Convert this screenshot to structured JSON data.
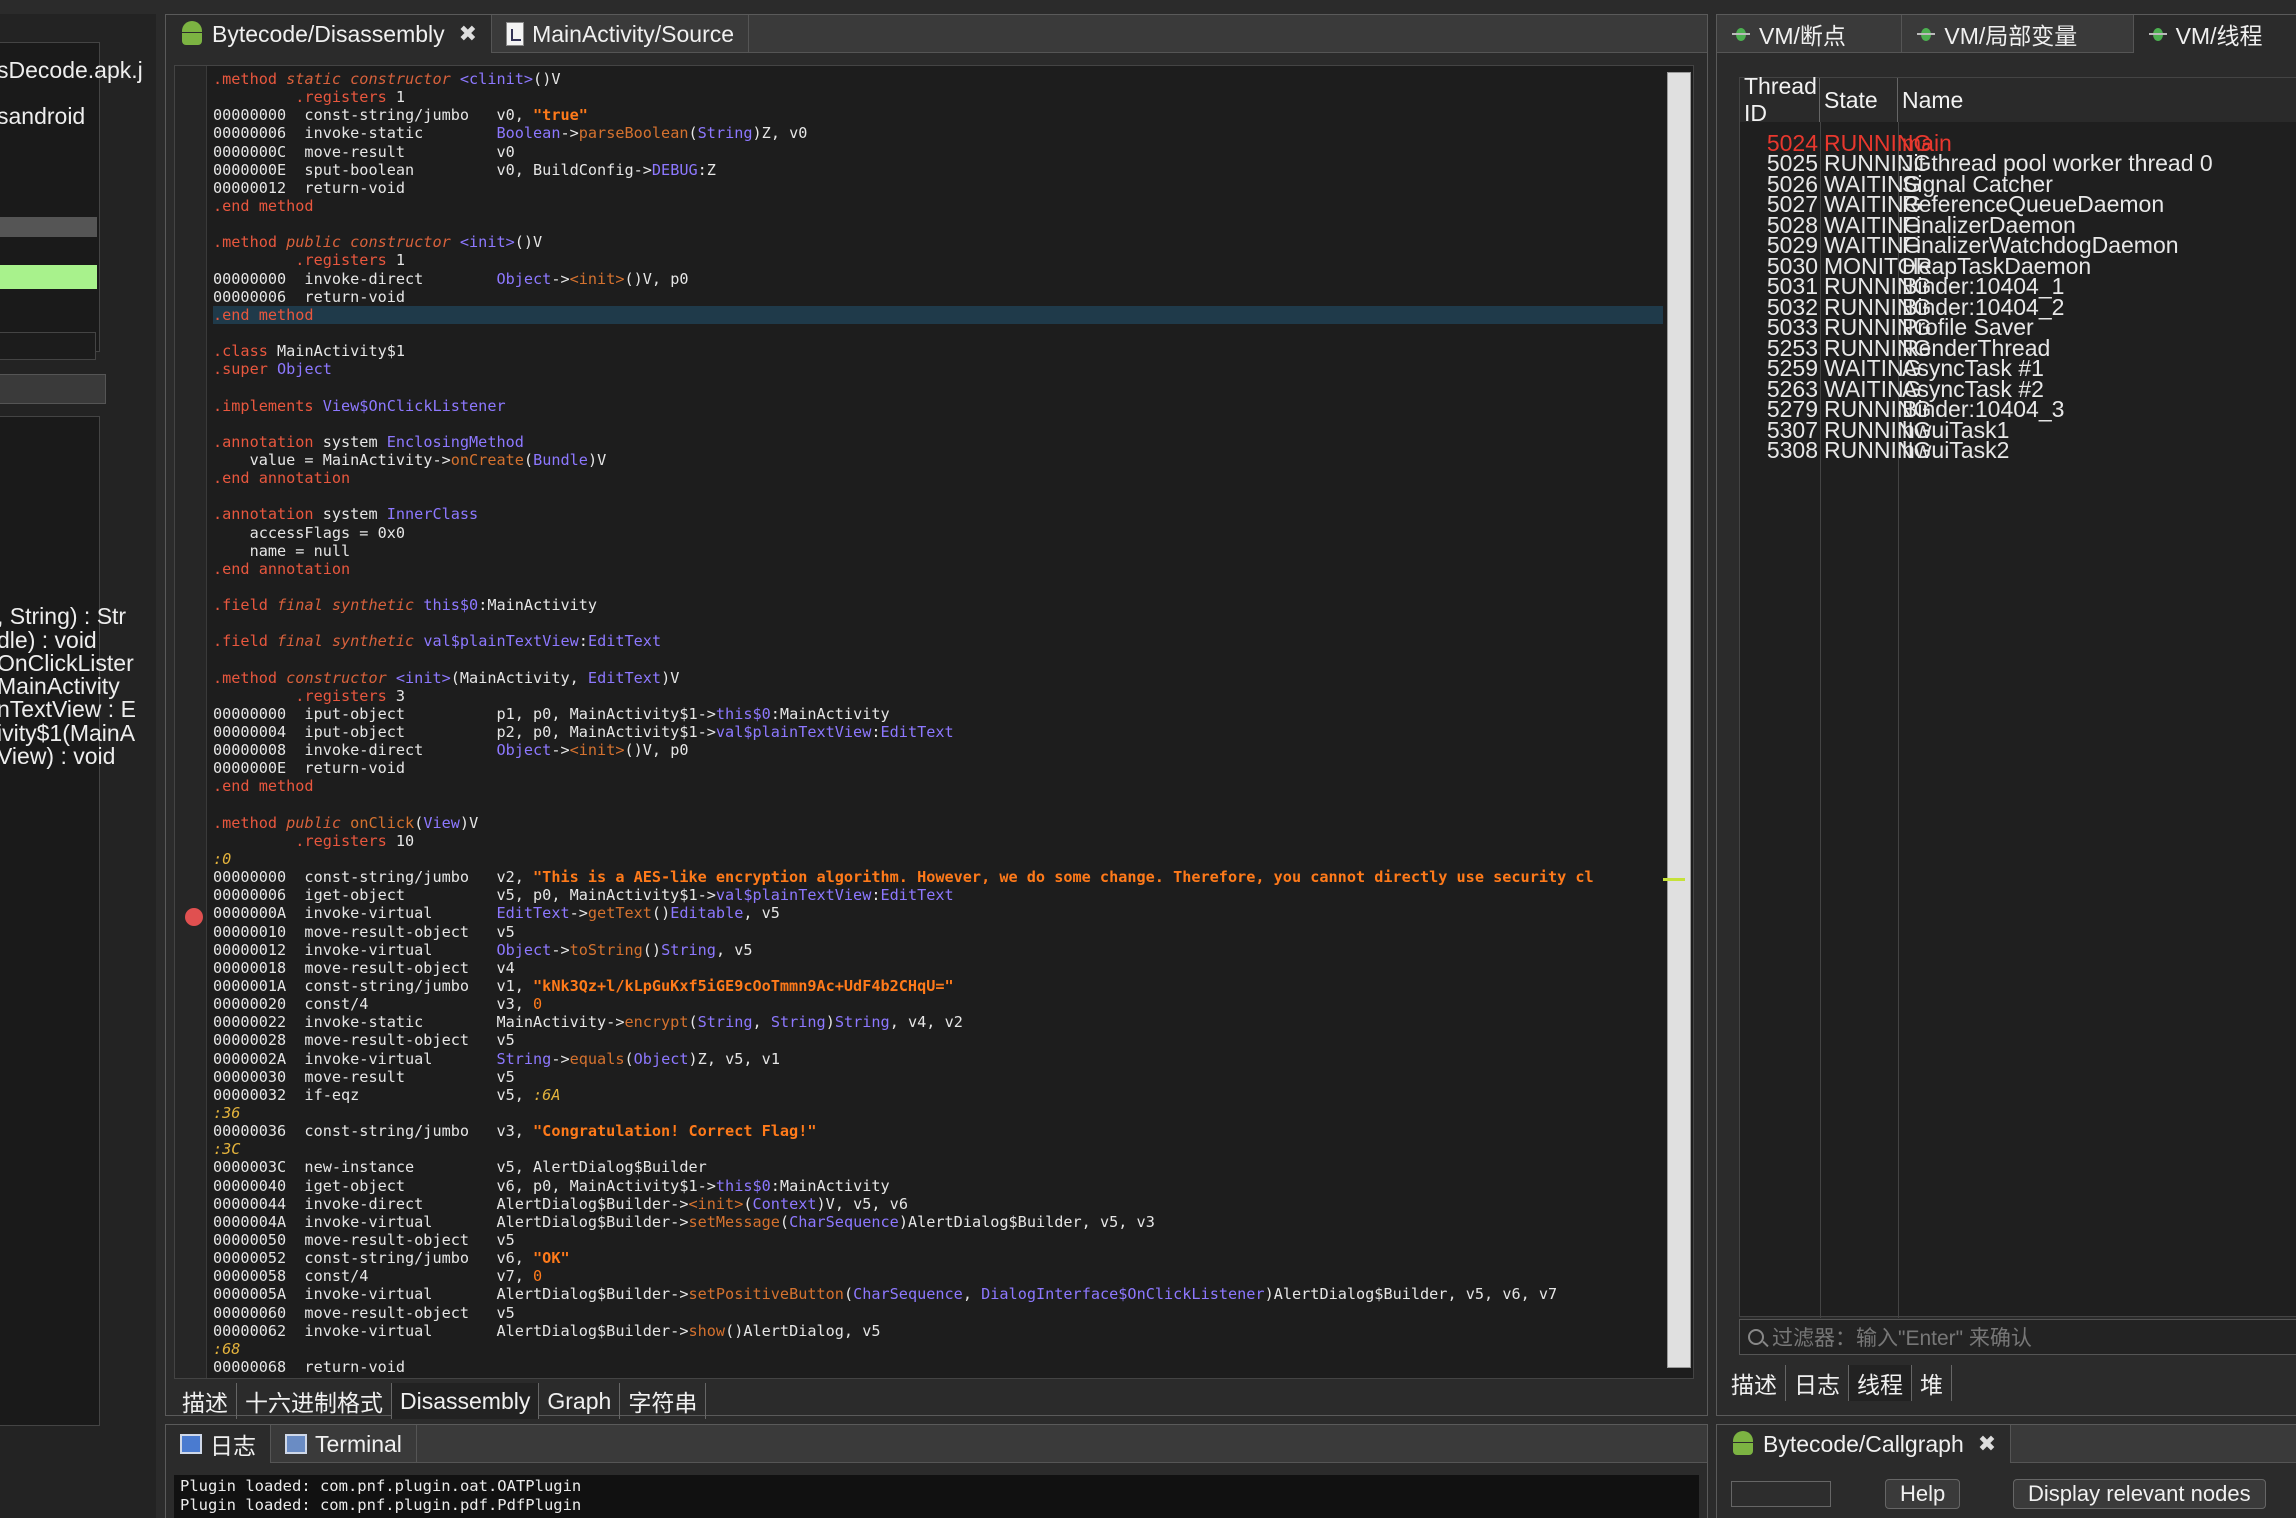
{
  "left_panel": {
    "lines_top": [
      "sDecode.apk.j",
      "sandroid"
    ],
    "lines_members": [
      ", String) : Str",
      "dle) : void",
      "OnClickLister",
      "MainActivity",
      "nTextView : E",
      "ivity$1(MainA",
      "View) : void"
    ]
  },
  "center": {
    "tabs": [
      {
        "label": "Bytecode/Disassembly",
        "close": "✖"
      },
      {
        "label": "MainActivity/Source"
      }
    ],
    "bottom_tabs": [
      "描述",
      "十六进制格式",
      "Disassembly",
      "Graph",
      "字符串"
    ],
    "code": [
      [
        [
          "kw",
          ".method "
        ],
        [
          "it",
          "static constructor "
        ],
        [
          "ty",
          "<clinit>"
        ],
        [
          "",
          "()V"
        ]
      ],
      [
        [
          "",
          "         "
        ],
        [
          "kw",
          ".registers "
        ],
        [
          "",
          "1"
        ]
      ],
      [
        [
          "",
          "00000000  const-string/jumbo   v0, "
        ],
        [
          "str",
          "\"true\""
        ]
      ],
      [
        [
          "",
          "00000006  invoke-static        "
        ],
        [
          "ty",
          "Boolean"
        ],
        [
          "",
          "->"
        ],
        [
          "fn",
          "parseBoolean"
        ],
        [
          "",
          "("
        ],
        [
          "ty",
          "String"
        ],
        [
          "",
          ")Z, v0"
        ]
      ],
      [
        [
          "",
          "0000000C  move-result          v0"
        ]
      ],
      [
        [
          "",
          "0000000E  sput-boolean         v0, BuildConfig->"
        ],
        [
          "ty",
          "DEBUG"
        ],
        [
          "",
          ":Z"
        ]
      ],
      [
        [
          "",
          "00000012  return-void"
        ]
      ],
      [
        [
          "kw",
          ".end method"
        ]
      ],
      [
        [
          "",
          ""
        ]
      ],
      [
        [
          "kw",
          ".method "
        ],
        [
          "it",
          "public constructor "
        ],
        [
          "ty",
          "<init>"
        ],
        [
          "",
          "()V"
        ]
      ],
      [
        [
          "",
          "         "
        ],
        [
          "kw",
          ".registers "
        ],
        [
          "",
          "1"
        ]
      ],
      [
        [
          "",
          "00000000  invoke-direct        "
        ],
        [
          "ty",
          "Object"
        ],
        [
          "",
          "->"
        ],
        [
          "fn",
          "<init>"
        ],
        [
          "",
          "()V, p0"
        ]
      ],
      [
        [
          "",
          "00000006  return-void"
        ]
      ],
      [
        [
          "kw",
          ".end method"
        ]
      ],
      [
        [
          "",
          ""
        ]
      ],
      [
        [
          "kw",
          ".class "
        ],
        [
          "",
          "MainActivity$1"
        ]
      ],
      [
        [
          "kw",
          ".super "
        ],
        [
          "ty",
          "Object"
        ]
      ],
      [
        [
          "",
          ""
        ]
      ],
      [
        [
          "kw",
          ".implements "
        ],
        [
          "ty",
          "View$OnClickListener"
        ]
      ],
      [
        [
          "",
          ""
        ]
      ],
      [
        [
          "kw",
          ".annotation "
        ],
        [
          "",
          "system "
        ],
        [
          "ty",
          "EnclosingMethod"
        ]
      ],
      [
        [
          "",
          "    value = MainActivity->"
        ],
        [
          "fn",
          "onCreate"
        ],
        [
          "",
          "("
        ],
        [
          "ty",
          "Bundle"
        ],
        [
          "",
          ")V"
        ]
      ],
      [
        [
          "kw",
          ".end annotation"
        ]
      ],
      [
        [
          "",
          ""
        ]
      ],
      [
        [
          "kw",
          ".annotation "
        ],
        [
          "",
          "system "
        ],
        [
          "ty",
          "InnerClass"
        ]
      ],
      [
        [
          "",
          "    accessFlags = 0x0"
        ]
      ],
      [
        [
          "",
          "    name = null"
        ]
      ],
      [
        [
          "kw",
          ".end annotation"
        ]
      ],
      [
        [
          "",
          ""
        ]
      ],
      [
        [
          "kw",
          ".field "
        ],
        [
          "it",
          "final synthetic "
        ],
        [
          "ty",
          "this$0"
        ],
        [
          "",
          ":MainActivity"
        ]
      ],
      [
        [
          "",
          ""
        ]
      ],
      [
        [
          "kw",
          ".field "
        ],
        [
          "it",
          "final synthetic "
        ],
        [
          "ty",
          "val$plainTextView"
        ],
        [
          "",
          ":"
        ],
        [
          "ty",
          "EditText"
        ]
      ],
      [
        [
          "",
          ""
        ]
      ],
      [
        [
          "kw",
          ".method "
        ],
        [
          "it",
          "constructor "
        ],
        [
          "ty",
          "<init>"
        ],
        [
          "",
          "(MainActivity, "
        ],
        [
          "ty",
          "EditText"
        ],
        [
          "",
          ")V"
        ]
      ],
      [
        [
          "",
          "         "
        ],
        [
          "kw",
          ".registers "
        ],
        [
          "",
          "3"
        ]
      ],
      [
        [
          "",
          "00000000  iput-object          p1, p0, MainActivity$1->"
        ],
        [
          "ty",
          "this$0"
        ],
        [
          "",
          ":MainActivity"
        ]
      ],
      [
        [
          "",
          "00000004  iput-object          p2, p0, MainActivity$1->"
        ],
        [
          "ty",
          "val$plainTextView"
        ],
        [
          "",
          ":"
        ],
        [
          "ty",
          "EditText"
        ]
      ],
      [
        [
          "",
          "00000008  invoke-direct        "
        ],
        [
          "ty",
          "Object"
        ],
        [
          "",
          "->"
        ],
        [
          "fn",
          "<init>"
        ],
        [
          "",
          "()V, p0"
        ]
      ],
      [
        [
          "",
          "0000000E  return-void"
        ]
      ],
      [
        [
          "kw",
          ".end method"
        ]
      ],
      [
        [
          "",
          ""
        ]
      ],
      [
        [
          "kw",
          ".method "
        ],
        [
          "it",
          "public "
        ],
        [
          "fn",
          "onClick"
        ],
        [
          "",
          "("
        ],
        [
          "ty",
          "View"
        ],
        [
          "",
          ")V"
        ]
      ],
      [
        [
          "",
          "         "
        ],
        [
          "kw",
          ".registers "
        ],
        [
          "",
          "10"
        ]
      ],
      [
        [
          "lbl",
          ":0"
        ]
      ],
      [
        [
          "",
          "00000000  const-string/jumbo   v2, "
        ],
        [
          "str",
          "\"This is a AES-like encryption algorithm. However, we do some change. Therefore, you cannot directly use security cl"
        ]
      ],
      [
        [
          "",
          "00000006  iget-object          v5, p0, MainActivity$1->"
        ],
        [
          "ty",
          "val$plainTextView"
        ],
        [
          "",
          ":"
        ],
        [
          "ty",
          "EditText"
        ]
      ],
      [
        [
          "",
          "0000000A  invoke-virtual       "
        ],
        [
          "ty",
          "EditText"
        ],
        [
          "",
          "->"
        ],
        [
          "fn",
          "getText"
        ],
        [
          "",
          "()"
        ],
        [
          "ty",
          "Editable"
        ],
        [
          "",
          ", v5"
        ]
      ],
      [
        [
          "",
          "00000010  move-result-object   v5"
        ]
      ],
      [
        [
          "",
          "00000012  invoke-virtual       "
        ],
        [
          "ty",
          "Object"
        ],
        [
          "",
          "->"
        ],
        [
          "fn",
          "toString"
        ],
        [
          "",
          "()"
        ],
        [
          "ty",
          "String"
        ],
        [
          "",
          ", v5"
        ]
      ],
      [
        [
          "",
          "00000018  move-result-object   v4"
        ]
      ],
      [
        [
          "",
          "0000001A  const-string/jumbo   v1, "
        ],
        [
          "str",
          "\"kNk3Qz+l/kLpGuKxf5iGE9cOoTmmn9Ac+UdF4b2CHqU=\""
        ]
      ],
      [
        [
          "",
          "00000020  const/4              v3, "
        ],
        [
          "num",
          "0"
        ]
      ],
      [
        [
          "",
          "00000022  invoke-static        MainActivity->"
        ],
        [
          "fn",
          "encrypt"
        ],
        [
          "",
          "("
        ],
        [
          "ty",
          "String"
        ],
        [
          "",
          ", "
        ],
        [
          "ty",
          "String"
        ],
        [
          "",
          ")"
        ],
        [
          "ty",
          "String"
        ],
        [
          "",
          ", v4, v2"
        ]
      ],
      [
        [
          "",
          "00000028  move-result-object   v5"
        ]
      ],
      [
        [
          "",
          "0000002A  invoke-virtual       "
        ],
        [
          "ty",
          "String"
        ],
        [
          "",
          "->"
        ],
        [
          "fn",
          "equals"
        ],
        [
          "",
          "("
        ],
        [
          "ty",
          "Object"
        ],
        [
          "",
          ")Z, v5, v1"
        ]
      ],
      [
        [
          "",
          "00000030  move-result          v5"
        ]
      ],
      [
        [
          "",
          "00000032  if-eqz               v5, "
        ],
        [
          "lbl",
          ":6A"
        ]
      ],
      [
        [
          "lbl",
          ":36"
        ]
      ],
      [
        [
          "",
          "00000036  const-string/jumbo   v3, "
        ],
        [
          "str",
          "\"Congratulation! Correct Flag!\""
        ]
      ],
      [
        [
          "lbl",
          ":3C"
        ]
      ],
      [
        [
          "",
          "0000003C  new-instance         v5, AlertDialog$Builder"
        ]
      ],
      [
        [
          "",
          "00000040  iget-object          v6, p0, MainActivity$1->"
        ],
        [
          "ty",
          "this$0"
        ],
        [
          "",
          ":MainActivity"
        ]
      ],
      [
        [
          "",
          "00000044  invoke-direct        AlertDialog$Builder->"
        ],
        [
          "fn",
          "<init>"
        ],
        [
          "",
          "("
        ],
        [
          "ty",
          "Context"
        ],
        [
          "",
          ")V, v5, v6"
        ]
      ],
      [
        [
          "",
          "0000004A  invoke-virtual       AlertDialog$Builder->"
        ],
        [
          "fn",
          "setMessage"
        ],
        [
          "",
          "("
        ],
        [
          "ty",
          "CharSequence"
        ],
        [
          "",
          ")AlertDialog$Builder, v5, v3"
        ]
      ],
      [
        [
          "",
          "00000050  move-result-object   v5"
        ]
      ],
      [
        [
          "",
          "00000052  const-string/jumbo   v6, "
        ],
        [
          "str",
          "\"OK\""
        ]
      ],
      [
        [
          "",
          "00000058  const/4              v7, "
        ],
        [
          "num",
          "0"
        ]
      ],
      [
        [
          "",
          "0000005A  invoke-virtual       AlertDialog$Builder->"
        ],
        [
          "fn",
          "setPositiveButton"
        ],
        [
          "",
          "("
        ],
        [
          "ty",
          "CharSequence"
        ],
        [
          "",
          ", "
        ],
        [
          "ty",
          "DialogInterface$OnClickListener"
        ],
        [
          "",
          ")AlertDialog$Builder, v5, v6, v7"
        ]
      ],
      [
        [
          "",
          "00000060  move-result-object   v5"
        ]
      ],
      [
        [
          "",
          "00000062  invoke-virtual       AlertDialog$Builder->"
        ],
        [
          "fn",
          "show"
        ],
        [
          "",
          "()AlertDialog, v5"
        ]
      ],
      [
        [
          "lbl",
          ":68"
        ]
      ],
      [
        [
          "",
          "00000068  return-void"
        ]
      ]
    ]
  },
  "vm": {
    "tabs": [
      "VM/断点",
      "VM/局部变量",
      "VM/线程"
    ],
    "columns": [
      "Thread ID",
      "State",
      "Name"
    ],
    "threads": [
      {
        "id": "5024",
        "state": "RUNNING",
        "name": "main"
      },
      {
        "id": "5025",
        "state": "RUNNING",
        "name": "Jit thread pool worker thread 0"
      },
      {
        "id": "5026",
        "state": "WAITING",
        "name": "Signal Catcher"
      },
      {
        "id": "5027",
        "state": "WAITING",
        "name": "ReferenceQueueDaemon"
      },
      {
        "id": "5028",
        "state": "WAITING",
        "name": "FinalizerDaemon"
      },
      {
        "id": "5029",
        "state": "WAITING",
        "name": "FinalizerWatchdogDaemon"
      },
      {
        "id": "5030",
        "state": "MONITOR",
        "name": "HeapTaskDaemon"
      },
      {
        "id": "5031",
        "state": "RUNNING",
        "name": "Binder:10404_1"
      },
      {
        "id": "5032",
        "state": "RUNNING",
        "name": "Binder:10404_2"
      },
      {
        "id": "5033",
        "state": "RUNNING",
        "name": "Profile Saver"
      },
      {
        "id": "5253",
        "state": "RUNNING",
        "name": "RenderThread"
      },
      {
        "id": "5259",
        "state": "WAITING",
        "name": "AsyncTask #1"
      },
      {
        "id": "5263",
        "state": "WAITING",
        "name": "AsyncTask #2"
      },
      {
        "id": "5279",
        "state": "RUNNING",
        "name": "Binder:10404_3"
      },
      {
        "id": "5307",
        "state": "RUNNING",
        "name": "hwuiTask1"
      },
      {
        "id": "5308",
        "state": "RUNNING",
        "name": "hwuiTask2"
      }
    ],
    "filter_placeholder": "过滤器：输入\"Enter\" 来确认",
    "bottom_tabs": [
      "描述",
      "日志",
      "线程",
      "堆"
    ]
  },
  "log": {
    "tabs": [
      "日志",
      "Terminal"
    ],
    "lines": [
      "Plugin loaded: com.pnf.plugin.oat.OATPlugin",
      "Plugin loaded: com.pnf.plugin.pdf.PdfPlugin"
    ]
  },
  "callgraph": {
    "tab_label": "Bytecode/Callgraph",
    "close": "✖",
    "help_label": "Help",
    "relevant_label": "Display relevant nodes"
  },
  "colors": {
    "keyword": "#e8573e",
    "type": "#8d78ff",
    "string": "#ff7a1a",
    "main_thread": "#e8382e",
    "selection_green": "#a8f28c"
  }
}
